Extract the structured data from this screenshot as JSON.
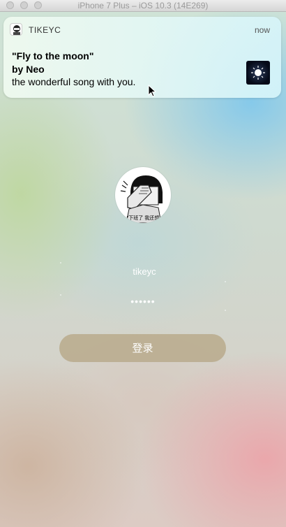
{
  "window": {
    "title": "iPhone 7 Plus – iOS 10.3 (14E269)"
  },
  "notification": {
    "app_name": "TIKEYC",
    "time": "now",
    "title_line1": "\"Fly to the moon\"",
    "title_line2": "by Neo",
    "body": "the wonderful song with you."
  },
  "avatar": {
    "caption": "\"下班了 我还想"
  },
  "login": {
    "username": "tikeyc",
    "password_mask": "••••••",
    "submit_label": "登录"
  },
  "colors": {
    "login_button": "#b9aa8c",
    "notification_bg": "#e6f7f5",
    "text_light": "#ffffff"
  }
}
